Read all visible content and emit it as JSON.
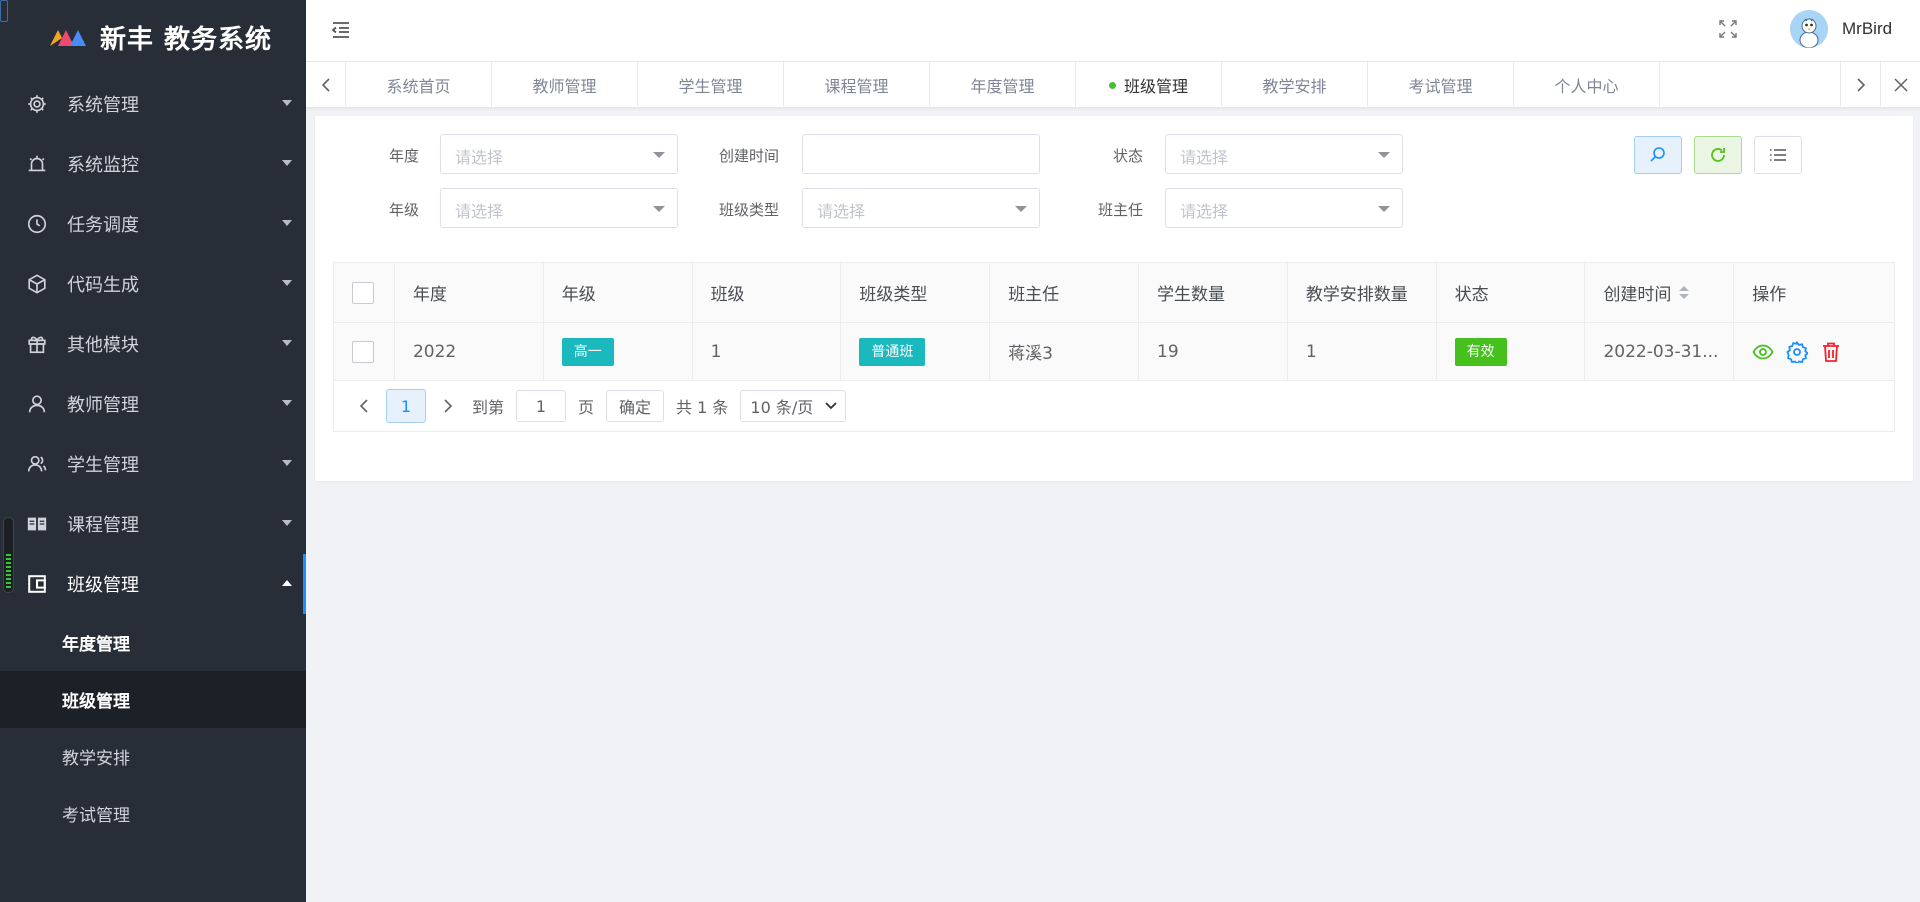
{
  "app": {
    "title": "新丰 教务系统",
    "accent": "#1890ff",
    "sidebar_bg": "#282e37"
  },
  "sidebar": {
    "items": [
      {
        "label": "系统管理",
        "icon": "gear-icon"
      },
      {
        "label": "系统监控",
        "icon": "alarm-icon"
      },
      {
        "label": "任务调度",
        "icon": "clock-icon"
      },
      {
        "label": "代码生成",
        "icon": "cube-icon"
      },
      {
        "label": "其他模块",
        "icon": "gift-icon"
      },
      {
        "label": "教师管理",
        "icon": "user-icon"
      },
      {
        "label": "学生管理",
        "icon": "users-icon"
      },
      {
        "label": "课程管理",
        "icon": "book-icon"
      },
      {
        "label": "班级管理",
        "icon": "wallet-icon",
        "open": true
      }
    ],
    "subitems": [
      {
        "label": "年度管理"
      },
      {
        "label": "班级管理",
        "active": true
      },
      {
        "label": "教学安排"
      },
      {
        "label": "考试管理"
      }
    ]
  },
  "header": {
    "username": "MrBird"
  },
  "tabs": [
    {
      "label": "系统首页"
    },
    {
      "label": "教师管理"
    },
    {
      "label": "学生管理"
    },
    {
      "label": "课程管理"
    },
    {
      "label": "年度管理"
    },
    {
      "label": "班级管理",
      "active": true
    },
    {
      "label": "教学安排"
    },
    {
      "label": "考试管理"
    },
    {
      "label": "个人中心"
    }
  ],
  "filters": {
    "year_label": "年度",
    "year_placeholder": "请选择",
    "created_label": "创建时间",
    "created_value": "",
    "status_label": "状态",
    "status_placeholder": "请选择",
    "grade_label": "年级",
    "grade_placeholder": "请选择",
    "class_type_label": "班级类型",
    "class_type_placeholder": "请选择",
    "head_teacher_label": "班主任",
    "head_teacher_placeholder": "请选择"
  },
  "table": {
    "headers": [
      "年度",
      "年级",
      "班级",
      "班级类型",
      "班主任",
      "学生数量",
      "教学安排数量",
      "状态",
      "创建时间",
      "操作"
    ],
    "rows": [
      {
        "year": "2022",
        "grade": "高一",
        "class": "1",
        "class_type": "普通班",
        "head_teacher": "蒋溪3",
        "student_count": "19",
        "schedule_count": "1",
        "status": "有效",
        "created": "2022-03-31..."
      }
    ],
    "grade_tag_color": "#1ab9bd",
    "status_tag_color": "#45c01d"
  },
  "pagination": {
    "current_page": "1",
    "goto_label": "到第",
    "goto_value": "1",
    "page_suffix": "页",
    "confirm_label": "确定",
    "total_text": "共 1 条",
    "page_size": "10 条/页"
  }
}
